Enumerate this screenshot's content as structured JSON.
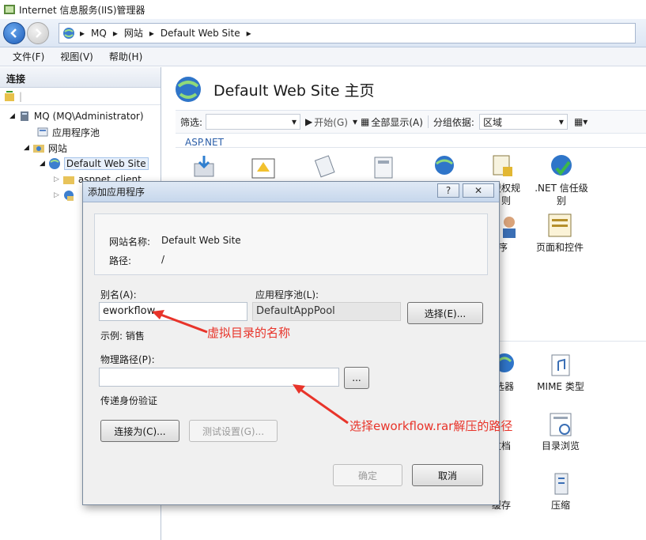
{
  "window": {
    "title": "Internet 信息服务(IIS)管理器"
  },
  "address": {
    "crumbs": [
      "MQ",
      "网站",
      "Default Web Site"
    ]
  },
  "menu": [
    "文件(F)",
    "视图(V)",
    "帮助(H)"
  ],
  "connections": {
    "header": "连接",
    "tree": [
      {
        "label": "MQ (MQ\\Administrator)"
      },
      {
        "label": "应用程序池"
      },
      {
        "label": "网站"
      },
      {
        "label": "Default Web Site"
      },
      {
        "label": "aspnet_client"
      }
    ]
  },
  "main": {
    "title": "Default Web Site 主页",
    "filter": {
      "label": "筛选:",
      "start": "开始(G)",
      "show_all": "全部显示(A)",
      "group_by": "分组依据:",
      "group_value": "区域"
    },
    "section": "ASP.NET",
    "features": [
      {
        "label": "授权规\n则"
      },
      {
        "label": ".NET 信任级\n别"
      },
      {
        "label": "程序"
      },
      {
        "label": "页面和控件"
      },
      {
        "label": "筛选器"
      },
      {
        "label": "MIME 类型"
      },
      {
        "label": "文档"
      },
      {
        "label": "目录浏览"
      },
      {
        "label": "缓存"
      },
      {
        "label": "压缩"
      }
    ]
  },
  "dialog": {
    "title": "添加应用程序",
    "help": "?",
    "close": "✕",
    "site_name_label": "网站名称:",
    "site_name_value": "Default Web Site",
    "path_label": "路径:",
    "path_value": "/",
    "alias_label": "别名(A):",
    "alias_value": "eworkflow",
    "pool_label": "应用程序池(L):",
    "pool_value": "DefaultAppPool",
    "select_button": "选择(E)...",
    "example": "示例: 销售",
    "physical_label": "物理路径(P):",
    "physical_value": "",
    "browse_button": "...",
    "pass_through": "传递身份验证",
    "connect_as": "连接为(C)...",
    "test_settings": "测试设置(G)...",
    "ok": "确定",
    "cancel": "取消"
  },
  "annotations": {
    "alias_note": "虚拟目录的名称",
    "path_note": "选择eworkflow.rar解压的路径"
  }
}
